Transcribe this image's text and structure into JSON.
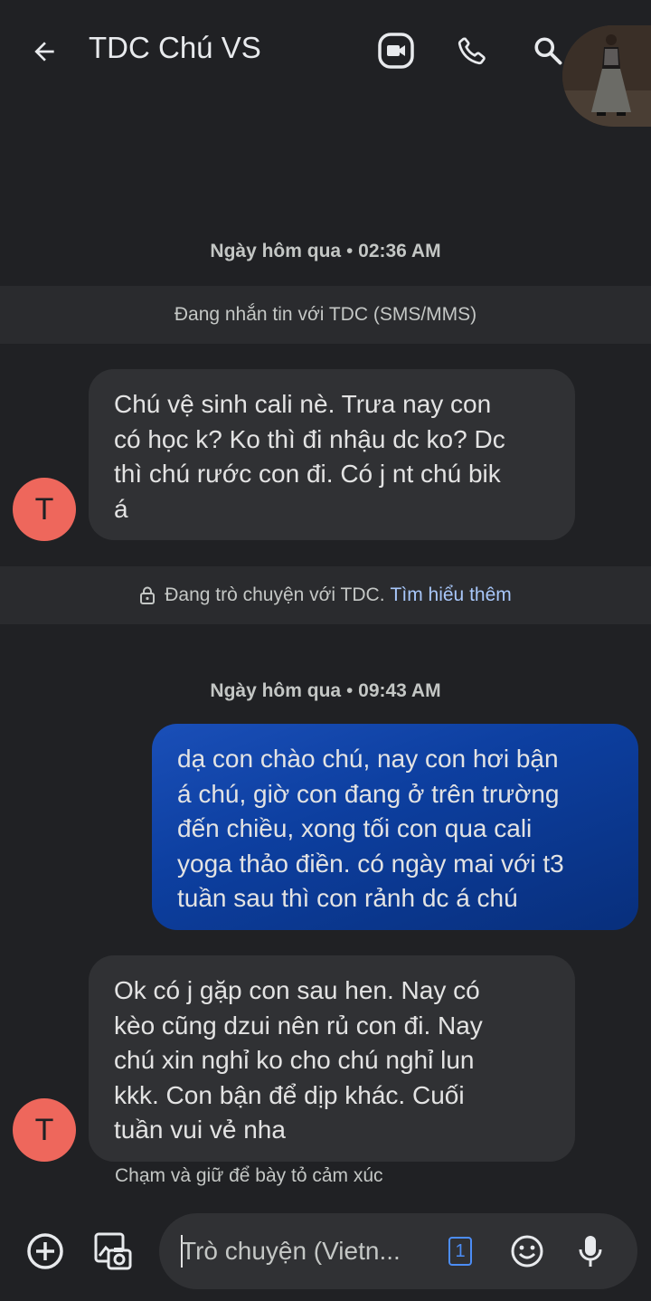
{
  "header": {
    "title": "TDC Chú VS"
  },
  "conversation": {
    "timestamp_1": {
      "day": "Ngày hôm qua",
      "sep": " • ",
      "time": "02:36 AM"
    },
    "sms_banner": "Đang nhắn tin với TDC (SMS/MMS)",
    "message_1": {
      "sender_initial": "T",
      "lines": [
        "Chú vệ sinh cali nè. Trưa nay con",
        "có học k? Ko thì đi nhậu dc ko? Dc",
        "thì chú rước con đi. Có j nt chú bik",
        "á"
      ]
    },
    "chat_banner": {
      "text": "Đang trò chuyện với TDC.",
      "link": "Tìm hiểu thêm"
    },
    "timestamp_2": {
      "day": "Ngày hôm qua",
      "sep": " • ",
      "time": "09:43 AM"
    },
    "message_2": {
      "lines": [
        "dạ con chào chú, nay con hơi bận",
        "á chú, giờ con đang ở trên trường",
        "đến chiều, xong tối con qua cali",
        "yoga thảo điền. có ngày mai với t3",
        "tuần sau thì con rảnh dc á chú"
      ]
    },
    "message_3": {
      "sender_initial": "T",
      "lines": [
        "Ok có j gặp con sau hen. Nay có",
        "kèo cũng dzui nên rủ con đi. Nay",
        "chú xin nghỉ ko cho chú nghỉ lun",
        "kkk. Con bận để dịp khác. Cuối",
        "tuần vui vẻ nha"
      ]
    },
    "reaction_hint": "Chạm và giữ để bày tỏ cảm xúc"
  },
  "composer": {
    "placeholder": "Trò chuyện (Vietn...",
    "sim_label": "1"
  },
  "colors": {
    "background": "#202124",
    "incoming_bubble": "#303134",
    "outgoing_bubble": "#0d3fa0",
    "avatar": "#ee675c",
    "link": "#a8c7fa"
  }
}
